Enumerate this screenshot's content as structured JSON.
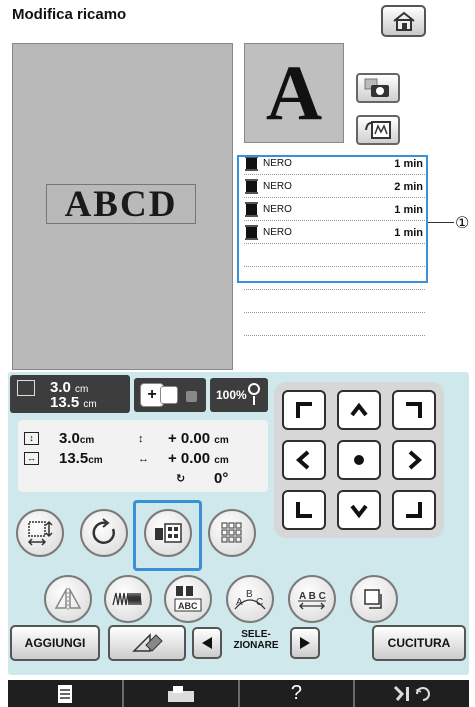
{
  "header": {
    "title": "Modifica ricamo"
  },
  "design": {
    "text": "ABCD",
    "preview_letter": "A"
  },
  "colors": [
    {
      "name": "NERO",
      "time": "1 min"
    },
    {
      "name": "NERO",
      "time": "2 min"
    },
    {
      "name": "NERO",
      "time": "1 min"
    },
    {
      "name": "NERO",
      "time": "1 min"
    }
  ],
  "callout": {
    "number": "①"
  },
  "size_panel": {
    "height": "3.0",
    "width": "13.5",
    "unit": "cm"
  },
  "zoom": {
    "label": "100%"
  },
  "info": {
    "height": "3.0",
    "width": "13.5",
    "unit": "cm",
    "offset_v": "+ 0.00",
    "offset_h": "+ 0.00",
    "angle": "0°"
  },
  "buttons": {
    "add": "AGGIUNGI",
    "select_line1": "SELE-",
    "select_line2": "ZIONARE",
    "sew": "CUCITURA",
    "help": "?"
  },
  "icons": {
    "home": "home-icon",
    "camera": "camera-icon",
    "scan": "scan-icon",
    "thread": "thread-spool-icon",
    "eraser": "delete-icon"
  },
  "colors_ui": {
    "accent": "#3b8fd6",
    "panel": "#cfe8ec",
    "design_bg": "#b9b9b9"
  }
}
